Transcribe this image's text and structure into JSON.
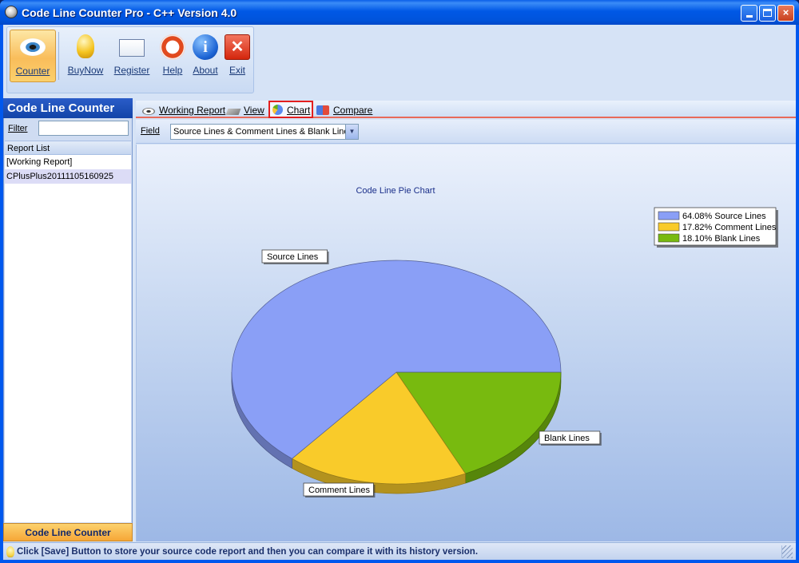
{
  "window": {
    "title": "Code Line Counter Pro - C++ Version 4.0"
  },
  "toolbar": {
    "buttons": [
      {
        "label": "Counter",
        "icon": "eye-icon"
      },
      {
        "label": "BuyNow",
        "icon": "key-icon"
      },
      {
        "label": "Register",
        "icon": "envelope-icon"
      },
      {
        "label": "Help",
        "icon": "lifebuoy-icon"
      },
      {
        "label": "About",
        "icon": "info-icon"
      },
      {
        "label": "Exit",
        "icon": "close-x-icon"
      }
    ]
  },
  "sidebar": {
    "header": "Code Line Counter",
    "filter_label": "Filter",
    "filter_value": "",
    "report_list_header": "Report List",
    "reports": [
      "[Working Report]",
      "CPlusPlus20111105160925"
    ],
    "footer": "Code Line Counter"
  },
  "tabs": [
    {
      "label": "Working Report"
    },
    {
      "label": "View"
    },
    {
      "label": "Chart",
      "active": true
    },
    {
      "label": "Compare"
    }
  ],
  "field": {
    "label": "Field",
    "value": "Source Lines & Comment Lines & Blank Lines"
  },
  "chart_data": {
    "type": "pie",
    "title": "Code Line Pie Chart",
    "slices": [
      {
        "label": "Source Lines",
        "value": 64.08,
        "color": "#8a9ff6",
        "legend": "64.08% Source Lines"
      },
      {
        "label": "Comment Lines",
        "value": 17.82,
        "color": "#f9cb2a",
        "legend": "17.82% Comment Lines"
      },
      {
        "label": "Blank Lines",
        "value": 18.1,
        "color": "#78ba0f",
        "legend": "18.10% Blank Lines"
      }
    ],
    "legend_position": "top-right"
  },
  "status": {
    "text": "Click [Save] Button to store your source code report and then you can compare it with its history version."
  },
  "caption_buttons": {
    "minimize": "_",
    "maximize": "□",
    "close": "×"
  }
}
